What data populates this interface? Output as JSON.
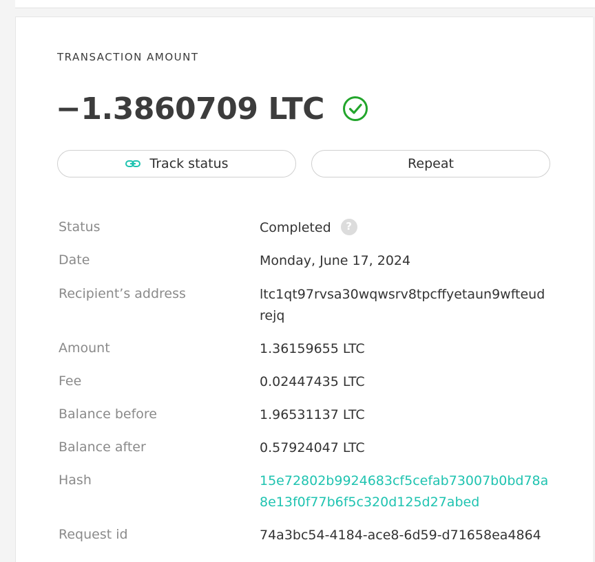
{
  "section_label": "TRANSACTION AMOUNT",
  "amount": "−1.3860709 LTC",
  "status_icon": "check-circle-icon",
  "colors": {
    "accent": "#1fc3b0",
    "success": "#22a52b"
  },
  "buttons": {
    "track_status": "Track status",
    "repeat": "Repeat"
  },
  "details": {
    "status": {
      "label": "Status",
      "value": "Completed"
    },
    "date": {
      "label": "Date",
      "value": "Monday, June 17, 2024"
    },
    "recipient": {
      "label": "Recipient’s address",
      "value_line1": "ltc1qt97rvsa30wqwsrv8tpcffyetaun9wfteud",
      "value_line2": "rejq"
    },
    "amount": {
      "label": "Amount",
      "value": "1.36159655 LTC"
    },
    "fee": {
      "label": "Fee",
      "value": "0.02447435 LTC"
    },
    "balance_before": {
      "label": "Balance before",
      "value": "1.96531137 LTC"
    },
    "balance_after": {
      "label": "Balance after",
      "value": "0.57924047 LTC"
    },
    "hash": {
      "label": "Hash",
      "value_line1": "15e72802b9924683cf5cefab73007b0bd78a",
      "value_line2": "8e13f0f77b6f5c320d125d27abed"
    },
    "request_id": {
      "label": "Request id",
      "value": "74a3bc54-4184-ace8-6d59-d71658ea4864"
    }
  },
  "help_icon_glyph": "?"
}
